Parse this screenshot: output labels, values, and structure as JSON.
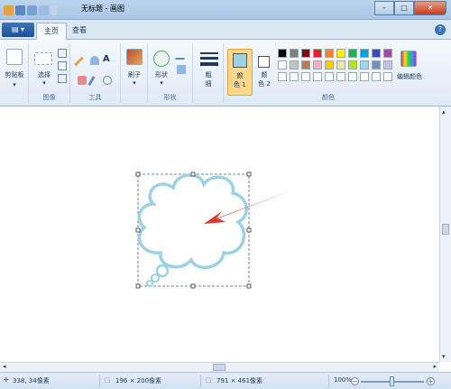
{
  "window": {
    "title": "无标题 - 画图"
  },
  "tabs": {
    "home": "主页",
    "view": "查看"
  },
  "ribbon": {
    "clipboard": {
      "paste": "剪贴板"
    },
    "image": {
      "group_label": "图像",
      "select": "选择"
    },
    "tools": {
      "group_label": "工具",
      "text_tool": "A"
    },
    "brushes": {
      "label": "刷子"
    },
    "shapes": {
      "group_label": "形状",
      "shapes_btn": "形状"
    },
    "size": {
      "label_line1": "粗",
      "label_line2": "细"
    },
    "colors": {
      "group_label": "颜色",
      "color1_line1": "颜",
      "color1_line2": "色 1",
      "color2_line1": "颜",
      "color2_line2": "色 2",
      "edit": "编辑颜色",
      "color1_value": "#9dd1e4",
      "color2_value": "#ffffff",
      "palette_row1": [
        "#000000",
        "#7f7f7f",
        "#880015",
        "#ed1c24",
        "#ff7f27",
        "#fff200",
        "#22b14c",
        "#00a2e8",
        "#3f48cc",
        "#a349a4"
      ],
      "palette_row2": [
        "#ffffff",
        "#c3c3c3",
        "#b97a57",
        "#ffaec9",
        "#ffc90e",
        "#efe4b0",
        "#b5e61d",
        "#99d9ea",
        "#7092be",
        "#c8bfe7"
      ]
    }
  },
  "status": {
    "cursor": "338, 34像素",
    "selection": "196 × 200像素",
    "canvas": "791 × 461像素",
    "zoom": "100%"
  },
  "drawing": {
    "shape": "thought-bubble",
    "outline_color": "#9dd1e4",
    "arrow_color": "#d93a2b"
  }
}
